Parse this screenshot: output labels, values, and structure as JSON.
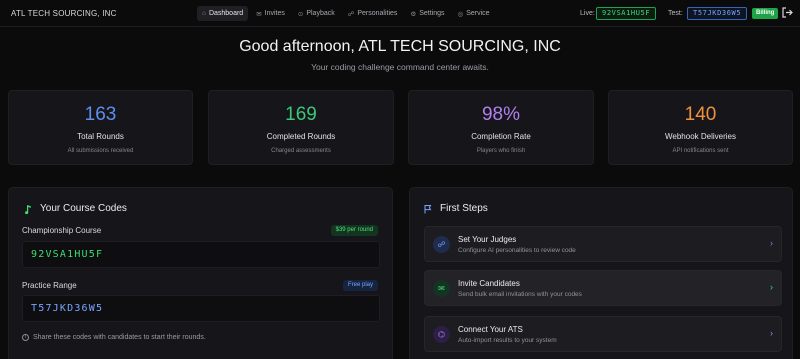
{
  "brand": "ATL TECH SOURCING, INC",
  "nav": [
    {
      "label": "Dashboard",
      "icon": "home-icon",
      "glyph": "⌂",
      "active": true
    },
    {
      "label": "Invites",
      "icon": "mail-icon",
      "glyph": "✉",
      "active": false
    },
    {
      "label": "Playback",
      "icon": "play-icon",
      "glyph": "⊙",
      "active": false
    },
    {
      "label": "Personalities",
      "icon": "users-icon",
      "glyph": "☍",
      "active": false
    },
    {
      "label": "Settings",
      "icon": "gear-icon",
      "glyph": "⚙",
      "active": false
    },
    {
      "label": "Service",
      "icon": "service-icon",
      "glyph": "◎",
      "active": false
    }
  ],
  "header": {
    "live_label": "Live:",
    "live_code": "92VSA1HU5F",
    "test_label": "Test:",
    "test_code": "T57JKD36W5",
    "billing_label": "Billing"
  },
  "greeting": {
    "title": "Good afternoon, ATL TECH SOURCING, INC",
    "subtitle": "Your coding challenge command center awaits."
  },
  "stats": [
    {
      "value": "163",
      "label": "Total Rounds",
      "sub": "All submissions received",
      "color": "#5d8ff0"
    },
    {
      "value": "169",
      "label": "Completed Rounds",
      "sub": "Charged assessments",
      "color": "#3bc77a"
    },
    {
      "value": "98%",
      "label": "Completion Rate",
      "sub": "Players who finish",
      "color": "#b27ff0"
    },
    {
      "value": "140",
      "label": "Webhook Deliveries",
      "sub": "API notifications sent",
      "color": "#f0913d"
    }
  ],
  "course_codes": {
    "title": "Your Course Codes",
    "icon": "music-note-icon",
    "championship_label": "Championship Course",
    "championship_badge": "$39 per round",
    "championship_code": "92VSA1HU5F",
    "practice_label": "Practice Range",
    "practice_badge": "Free play",
    "practice_code": "T57JKD36W5",
    "share_text": "Share these codes with candidates to start their rounds."
  },
  "first_steps": {
    "title": "First Steps",
    "icon": "flag-icon",
    "items": [
      {
        "title": "Set Your Judges",
        "desc": "Configure AI personalities to review code",
        "icon": "users-icon",
        "glyph": "☍",
        "bg": "#1f2c4d",
        "fg": "#7aa6ff"
      },
      {
        "title": "Invite Candidates",
        "desc": "Send bulk email invitations with your codes",
        "icon": "mail-icon",
        "glyph": "✉",
        "bg": "#143323",
        "fg": "#3ddc72"
      },
      {
        "title": "Connect Your ATS",
        "desc": "Auto-import results to your system",
        "icon": "plug-icon",
        "glyph": "⌬",
        "bg": "#2c1f45",
        "fg": "#b27ff0"
      }
    ]
  },
  "colors": {
    "accent_green": "#1fa347",
    "accent_blue": "#3a64b5"
  }
}
